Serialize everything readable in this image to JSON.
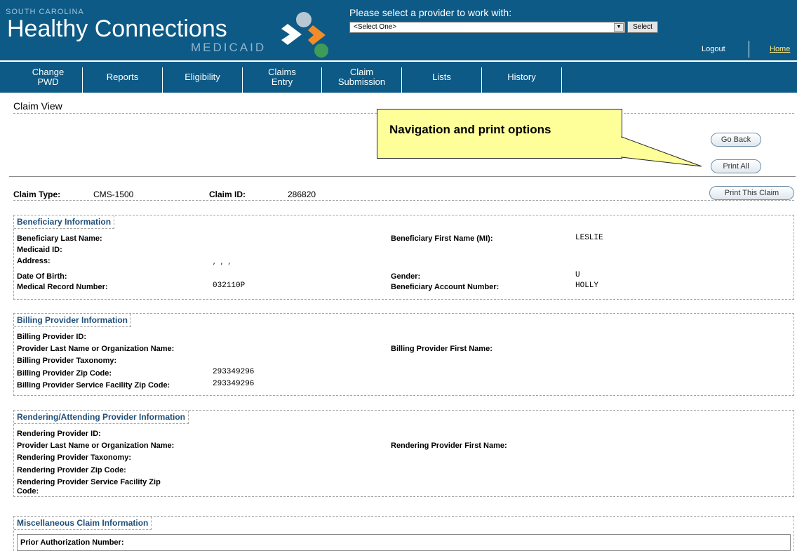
{
  "header": {
    "brand_top": "SOUTH CAROLINA",
    "brand_main": "Healthy Connections",
    "brand_sub": "MEDICAID",
    "provider_prompt": "Please select a provider to work with:",
    "provider_select_value": "<Select One>",
    "select_button": "Select",
    "logout": "Logout",
    "home": "Home",
    "colors": {
      "background": "#0d5a86",
      "home_link": "#ffe680"
    }
  },
  "nav": {
    "items": [
      {
        "label": "Change PWD"
      },
      {
        "label": "Reports"
      },
      {
        "label": "Eligibility"
      },
      {
        "label": "Claims Entry"
      },
      {
        "label": "Claim Submission"
      },
      {
        "label": "Lists"
      },
      {
        "label": "History"
      }
    ]
  },
  "page": {
    "title": "Claim View",
    "callout": "Navigation and print options",
    "buttons": {
      "go_back": "Go Back",
      "print_all": "Print All",
      "print_claim": "Print This Claim"
    }
  },
  "claim": {
    "type_label": "Claim Type:",
    "type_value": "CMS-1500",
    "id_label": "Claim ID:",
    "id_value": "286820"
  },
  "beneficiary": {
    "heading": "Beneficiary Information",
    "last_name_label": "Beneficiary Last Name:",
    "first_name_label": "Beneficiary First Name (MI):",
    "first_name_value": "LESLIE",
    "medicaid_id_label": "Medicaid ID:",
    "address_label": "Address:",
    "address_value": ", , ,",
    "dob_label": "Date Of Birth:",
    "gender_label": "Gender:",
    "gender_value": "U",
    "mrn_label": "Medical Record Number:",
    "mrn_value": "032110P",
    "account_label": "Beneficiary Account Number:",
    "account_value": "HOLLY"
  },
  "billing": {
    "heading": "Billing Provider Information",
    "id_label": "Billing Provider ID:",
    "last_name_label": "Provider Last Name or Organization Name:",
    "first_name_label": "Billing Provider First Name:",
    "taxonomy_label": "Billing Provider Taxonomy:",
    "zip_label": "Billing Provider Zip Code:",
    "zip_value": "293349296",
    "facility_zip_label": "Billing Provider Service Facility Zip Code:",
    "facility_zip_value": "293349296"
  },
  "rendering": {
    "heading": "Rendering/Attending Provider Information",
    "id_label": "Rendering Provider ID:",
    "last_name_label": "Provider Last Name or Organization Name:",
    "first_name_label": "Rendering Provider First Name:",
    "taxonomy_label": "Rendering Provider Taxonomy:",
    "zip_label": "Rendering Provider Zip Code:",
    "facility_zip_label_1": "Rendering Provider Service Facility Zip",
    "facility_zip_label_2": "Code:"
  },
  "misc": {
    "heading": "Miscellaneous Claim Information",
    "prior_auth_label": "Prior Authorization Number:"
  }
}
